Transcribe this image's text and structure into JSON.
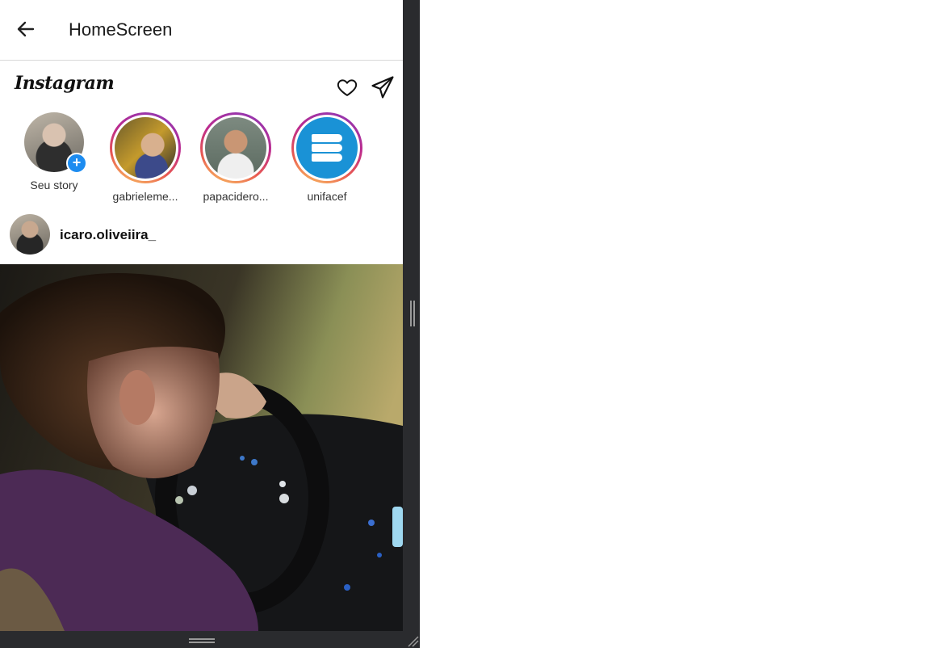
{
  "appbar": {
    "title": "HomeScreen",
    "back_icon": "arrow-left-icon"
  },
  "header": {
    "logo": "Instagram",
    "icons": [
      "heart-icon",
      "paper-plane-icon"
    ]
  },
  "stories": [
    {
      "label": "Seu story",
      "has_add_badge": true
    },
    {
      "label": "gabrieleme..."
    },
    {
      "label": "papacidero..."
    },
    {
      "label": "unifacef"
    }
  ],
  "post": {
    "username": "icaro.oliveiira_"
  },
  "colors": {
    "add_badge": "#1d8cf0",
    "story_ring_start": "#8a3ab9",
    "story_ring_end": "#fccc63",
    "frame": "#2a2b2e"
  }
}
